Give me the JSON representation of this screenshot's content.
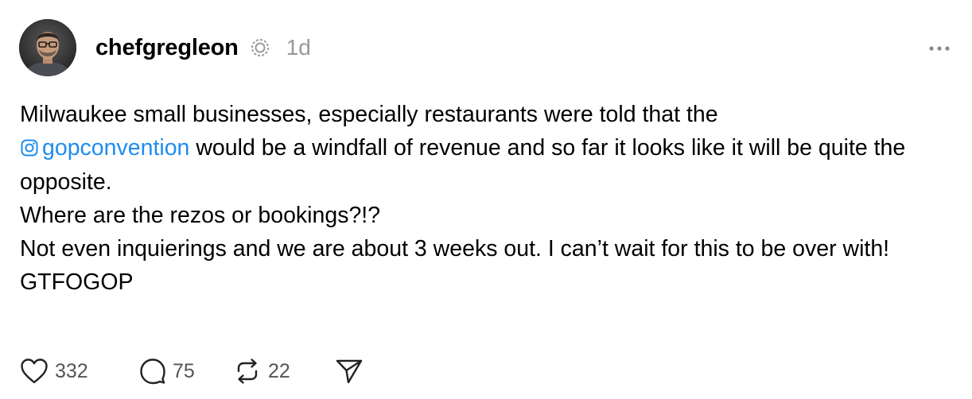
{
  "post": {
    "author": {
      "username": "chefgregleon",
      "avatar_icon": "avatar-photo",
      "verified_icon": "threads-badge-icon"
    },
    "timestamp": "1d",
    "more_icon": "more-horizontal-icon",
    "body": {
      "line1": "Milwaukee small businesses, especially restaurants were told that the",
      "mention": "gopconvention",
      "mention_icon": "instagram-icon",
      "line2_after_mention": " would be a windfall of revenue and so far it looks like it will be quite the opposite.",
      "line3": "Where are the rezos or bookings?!?",
      "line4": "Not even inquierings and we are about 3 weeks out. I can’t wait for this to be over with!",
      "line5": "GTFOGOP"
    },
    "actions": {
      "likes": "332",
      "comments": "75",
      "reposts": "22"
    },
    "colors": {
      "mention": "#1f8ded",
      "muted": "#999999",
      "count": "#555555"
    }
  }
}
